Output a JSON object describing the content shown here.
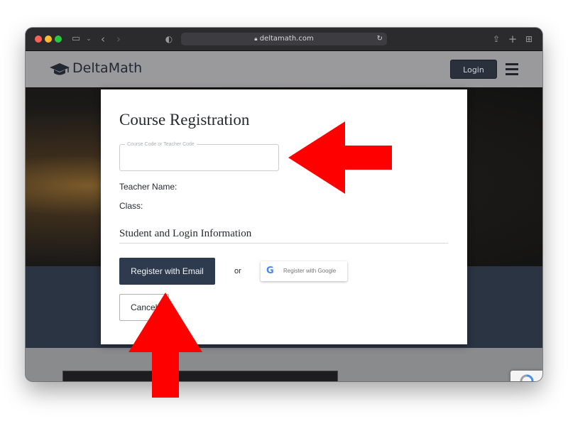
{
  "browser": {
    "url": "deltamath.com",
    "icons": {
      "sidebar": "sidebar-icon",
      "back": "chevron-left-icon",
      "forward": "chevron-right-icon",
      "shield": "shield-icon",
      "lock": "lock-icon",
      "reload": "reload-icon",
      "share": "share-icon",
      "new_tab": "plus-icon",
      "tabs": "tab-overview-icon"
    }
  },
  "site": {
    "brand": "DeltaMath",
    "login_label": "Login"
  },
  "modal": {
    "title": "Course Registration",
    "course_code_label": "Course Code or Teacher Code",
    "course_code_value": "",
    "teacher_name_label": "Teacher Name:",
    "class_label": "Class:",
    "section_title": "Student and Login Information",
    "register_email_label": "Register with Email",
    "or_text": "or",
    "register_google_label": "Register with Google",
    "cancel_label": "Cancel"
  },
  "colors": {
    "arrow": "#ff0000",
    "primary_button": "#2e3a4d",
    "nav_background": "#9a9a9c"
  }
}
